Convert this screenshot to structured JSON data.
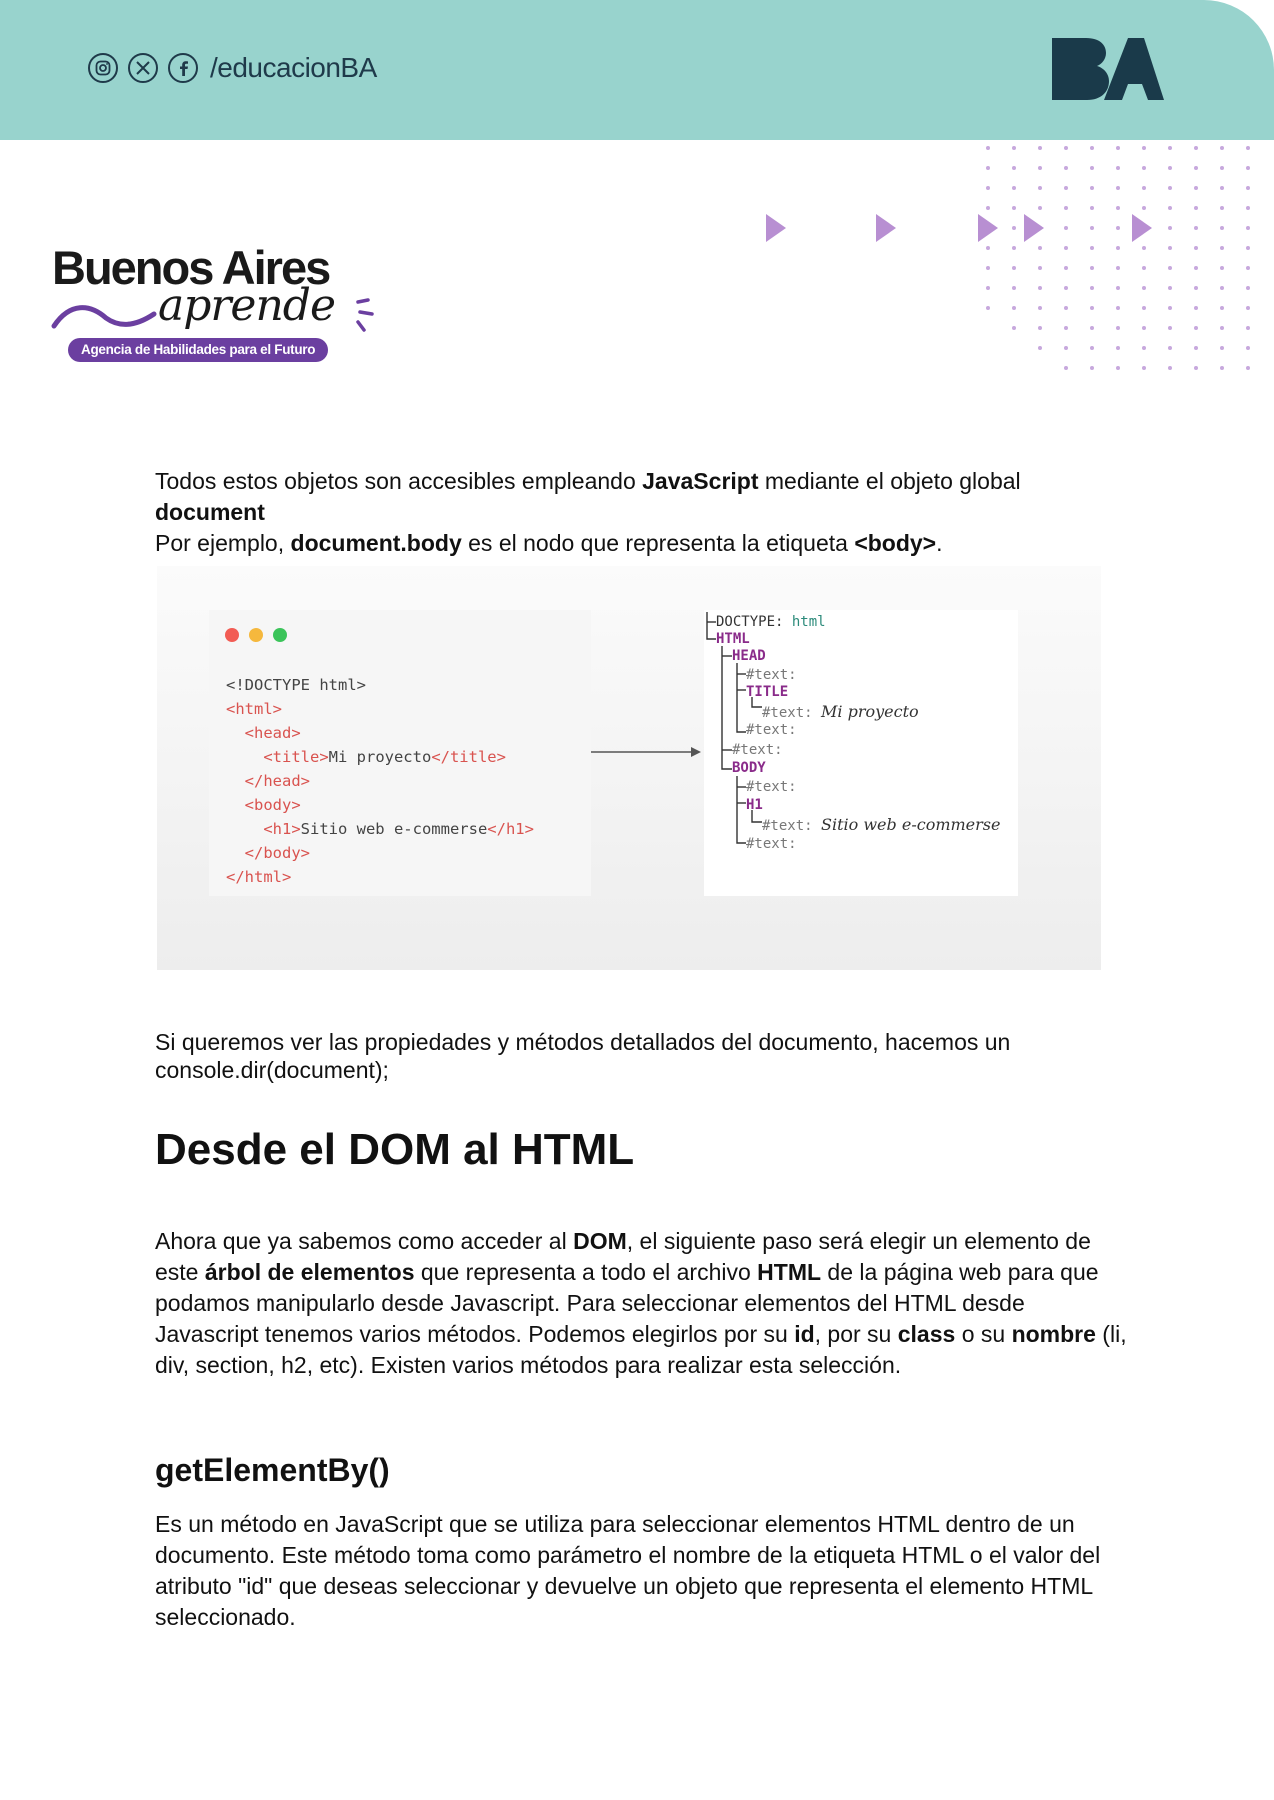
{
  "header": {
    "handle": "/educacionBA",
    "social_icons": [
      "instagram-icon",
      "x-icon",
      "facebook-icon"
    ],
    "logo_text": "BA",
    "colors": {
      "band": "#98d3cd",
      "dark": "#1f3a4a"
    }
  },
  "brand": {
    "title": "Buenos Aires",
    "script": "aprende",
    "tagline": "Agencia de Habilidades para el Futuro",
    "accent": "#6b3fa0"
  },
  "intro": {
    "p1_a": "Todos estos objetos son accesibles empleando ",
    "p1_b": "JavaScript",
    "p1_c": " mediante el objeto global ",
    "p1_d": "document",
    "p2_a": "Por ejemplo, ",
    "p2_b": "document.body",
    "p2_c": " es el nodo que representa la etiqueta ",
    "p2_d": "<body>",
    "p2_e": "."
  },
  "figure": {
    "code_lines": [
      {
        "text": "<!DOCTYPE html>",
        "tag": false
      },
      {
        "text": "<html>",
        "tag": true
      },
      {
        "text": "  <head>",
        "tag": true
      },
      {
        "text": "    <title>Mi proyecto</title>",
        "tag": "mixed",
        "parts": [
          "    ",
          "<title>",
          "Mi proyecto",
          "</title>"
        ]
      },
      {
        "text": "  </head>",
        "tag": true
      },
      {
        "text": "  <body>",
        "tag": true
      },
      {
        "text": "    <h1>Sitio web e-commerse</h1>",
        "tag": "mixed",
        "parts": [
          "    ",
          "<h1>",
          "Sitio web e-commerse",
          "</h1>"
        ]
      },
      {
        "text": "  </body>",
        "tag": true
      },
      {
        "text": "</html>",
        "tag": true
      }
    ],
    "tree": {
      "doctype_label": "DOCTYPE:",
      "doctype_value": "html",
      "html": "HTML",
      "head": "HEAD",
      "text": "#text:",
      "title": "TITLE",
      "title_value": "Mi proyecto",
      "body": "BODY",
      "h1": "H1",
      "h1_value": "Sitio web e-commerse"
    }
  },
  "console_para": {
    "line1": "Si queremos ver las propiedades y métodos detallados del documento, hacemos un",
    "line2": "console.dir(document);"
  },
  "section1": {
    "heading": "Desde el DOM al HTML",
    "t1": "Ahora que ya sabemos como acceder al ",
    "b1": "DOM",
    "t2": ", el siguiente paso será elegir un elemento de este ",
    "b2": "árbol de elementos",
    "t3": " que representa a todo el archivo ",
    "b3": "HTML",
    "t4": " de la página web para que podamos manipularlo desde Javascript. Para seleccionar elementos del HTML desde Javascript tenemos varios métodos. Podemos elegirlos por su ",
    "b4": "id",
    "t5": ", por su ",
    "b5": "class",
    "t6": " o su ",
    "b6": "nombre",
    "t7": " (li, div, section, h2, etc). Existen varios métodos para realizar esta selección."
  },
  "section2": {
    "heading": "getElementBy()",
    "body": "Es un método en JavaScript que se utiliza para seleccionar elementos HTML dentro de un documento. Este método toma como parámetro el nombre de la etiqueta HTML o el valor del atributo \"id\" que deseas seleccionar y devuelve un objeto que representa el elemento HTML seleccionado."
  }
}
